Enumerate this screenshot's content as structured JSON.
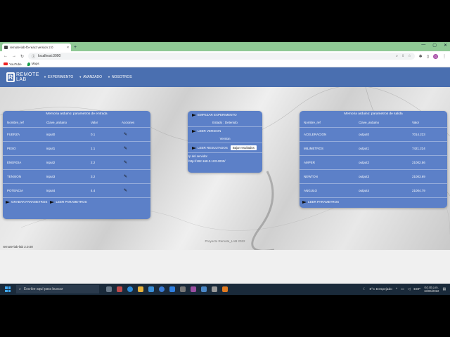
{
  "browser": {
    "tab_title": "remote-lab-fb-react version 2.0",
    "tab_close": "×",
    "new_tab": "+",
    "win_min": "—",
    "win_max": "▢",
    "win_close": "✕",
    "back": "←",
    "forward": "→",
    "reload": "↻",
    "url": "localhost:3000",
    "bookmarks": [
      "YouTube",
      "Maps"
    ],
    "profile_initial": "G"
  },
  "app": {
    "logo_letter": "R",
    "logo_line1": "REMOTE",
    "logo_line2": "LAB",
    "nav": [
      "EXPERIMENTO",
      "AVANZADO",
      "NOSOTROS"
    ]
  },
  "left_panel": {
    "title": "Memoria arduino: parametros de entrada",
    "headers": [
      "Nombre_ref",
      "Clave_arduino",
      "Valor",
      "Acciones"
    ],
    "rows": [
      {
        "name": "FUERZA",
        "key": "input0",
        "value": "0.1"
      },
      {
        "name": "PESO",
        "key": "input1",
        "value": "1.1"
      },
      {
        "name": "ENERGIA",
        "key": "input2",
        "value": "2.2"
      },
      {
        "name": "TENSION",
        "key": "input3",
        "value": "3.2"
      },
      {
        "name": "POTENCIA",
        "key": "input4",
        "value": "4.4"
      }
    ],
    "action_save": "GRABAR PARAMETROS",
    "action_read": "LEER PARAMETROS"
  },
  "middle_panel": {
    "start": "EMPEZAR EXPERIMENTO",
    "status": "Estado : Detenido",
    "read_version": "LEER VERSION",
    "version_label": "Version",
    "read_results": "LEER RESULTADOS",
    "download_results": "Bajar resultados",
    "server_label": "Ip del servidor",
    "server_value": "http://192.168.0.103:4000/"
  },
  "right_panel": {
    "title": "Memoria arduino: parametros de salida",
    "headers": [
      "Nombre_ref",
      "Clave_arduino",
      "Valor"
    ],
    "rows": [
      {
        "name": "ACELERACION",
        "key": "output0",
        "value": "7014.223"
      },
      {
        "name": "MILIMETROS",
        "key": "output1",
        "value": "7421.224"
      },
      {
        "name": "AMPER",
        "key": "output2",
        "value": "21002.56"
      },
      {
        "name": "NEWTON",
        "key": "output3",
        "value": "21003.69"
      },
      {
        "name": "ANGULO",
        "key": "output4",
        "value": "21004.79"
      }
    ],
    "action_read": "LEER PARAMETROS"
  },
  "footer": {
    "project": "Proyecto Remote_LAB 2022",
    "version": "remote-lab-lab 2.0.00"
  },
  "taskbar": {
    "search_placeholder": "Escribe aquí para buscar",
    "weather": "8°C  Despejado",
    "lang": "ESP",
    "time": "04:40 p.m.",
    "date": "18/06/2022"
  }
}
